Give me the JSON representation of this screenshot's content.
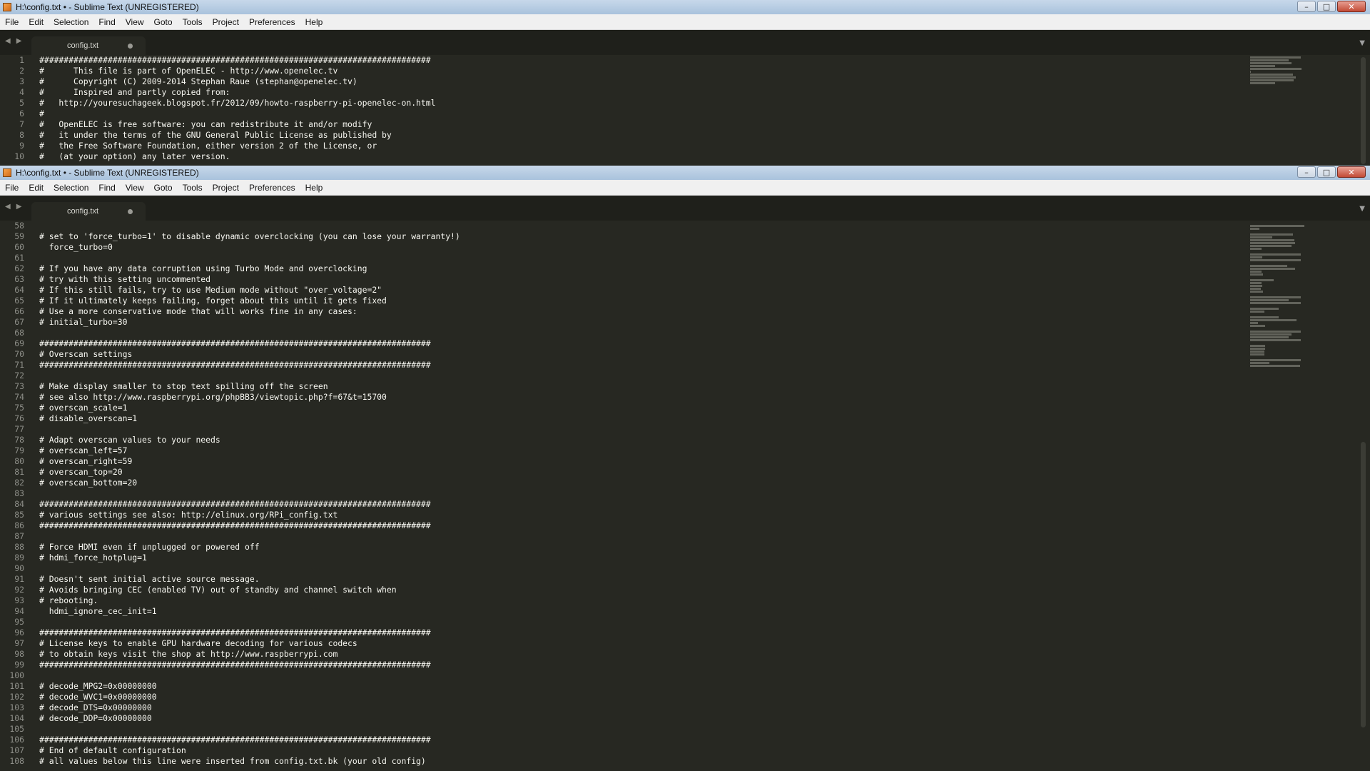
{
  "app": {
    "title": "H:\\config.txt • - Sublime Text (UNREGISTERED)",
    "menu": [
      "File",
      "Edit",
      "Selection",
      "Find",
      "View",
      "Goto",
      "Tools",
      "Project",
      "Preferences",
      "Help"
    ],
    "tab": "config.txt",
    "icons": {
      "back": "◀",
      "forward": "▶",
      "minimize": "–",
      "maximize": "□",
      "close": "✕",
      "dropdown": "▼"
    }
  },
  "panes": [
    {
      "first_line": 1,
      "lines": [
        "################################################################################",
        "#      This file is part of OpenELEC - http://www.openelec.tv",
        "#      Copyright (C) 2009-2014 Stephan Raue (stephan@openelec.tv)",
        "#      Inspired and partly copied from:",
        "#   http://youresuchageek.blogspot.fr/2012/09/howto-raspberry-pi-openelec-on.html",
        "#",
        "#   OpenELEC is free software: you can redistribute it and/or modify",
        "#   it under the terms of the GNU General Public License as published by",
        "#   the Free Software Foundation, either version 2 of the License, or",
        "#   (at your option) any later version."
      ]
    },
    {
      "first_line": 58,
      "lines": [
        "",
        "# set to 'force_turbo=1' to disable dynamic overclocking (you can lose your warranty!)",
        "  force_turbo=0",
        "",
        "# If you have any data corruption using Turbo Mode and overclocking",
        "# try with this setting uncommented",
        "# If this still fails, try to use Medium mode without \"over_voltage=2\"",
        "# If it ultimately keeps failing, forget about this until it gets fixed",
        "# Use a more conservative mode that will works fine in any cases:",
        "# initial_turbo=30",
        "",
        "################################################################################",
        "# Overscan settings",
        "################################################################################",
        "",
        "# Make display smaller to stop text spilling off the screen",
        "# see also http://www.raspberrypi.org/phpBB3/viewtopic.php?f=67&t=15700",
        "# overscan_scale=1",
        "# disable_overscan=1",
        "",
        "# Adapt overscan values to your needs",
        "# overscan_left=57",
        "# overscan_right=59",
        "# overscan_top=20",
        "# overscan_bottom=20",
        "",
        "################################################################################",
        "# various settings see also: http://elinux.org/RPi_config.txt",
        "################################################################################",
        "",
        "# Force HDMI even if unplugged or powered off",
        "# hdmi_force_hotplug=1",
        "",
        "# Doesn't sent initial active source message.",
        "# Avoids bringing CEC (enabled TV) out of standby and channel switch when",
        "# rebooting.",
        "  hdmi_ignore_cec_init=1",
        "",
        "################################################################################",
        "# License keys to enable GPU hardware decoding for various codecs",
        "# to obtain keys visit the shop at http://www.raspberrypi.com",
        "################################################################################",
        "",
        "# decode_MPG2=0x00000000",
        "# decode_WVC1=0x00000000",
        "# decode_DTS=0x00000000",
        "# decode_DDP=0x00000000",
        "",
        "################################################################################",
        "# End of default configuration",
        "# all values below this line were inserted from config.txt.bk (your old config)"
      ]
    }
  ]
}
